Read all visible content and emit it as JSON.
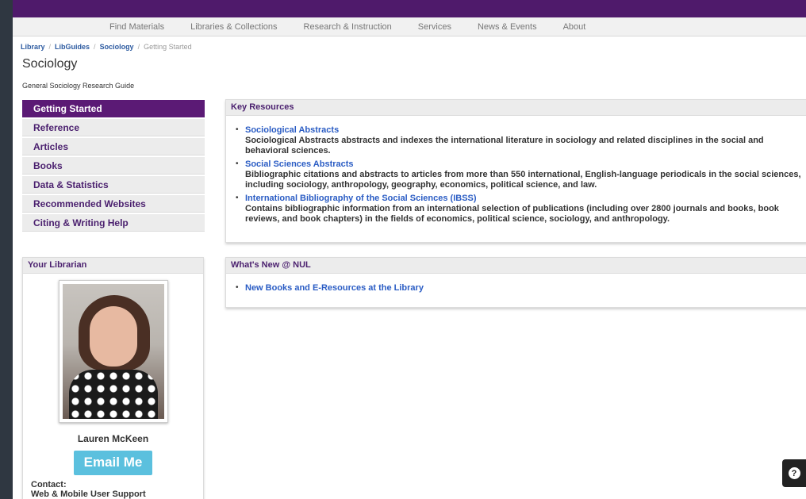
{
  "nav": {
    "items": [
      "Find Materials",
      "Libraries & Collections",
      "Research & Instruction",
      "Services",
      "News & Events",
      "About"
    ]
  },
  "breadcrumb": {
    "items": [
      "Library",
      "LibGuides",
      "Sociology"
    ],
    "current": "Getting Started"
  },
  "guide": {
    "title": "Sociology",
    "subtitle": "General Sociology Research Guide"
  },
  "sidenav": {
    "items": [
      {
        "label": "Getting Started",
        "active": true
      },
      {
        "label": "Reference",
        "active": false
      },
      {
        "label": "Articles",
        "active": false
      },
      {
        "label": "Books",
        "active": false
      },
      {
        "label": "Data & Statistics",
        "active": false
      },
      {
        "label": "Recommended Websites",
        "active": false
      },
      {
        "label": "Citing & Writing Help",
        "active": false
      }
    ]
  },
  "key_resources": {
    "heading": "Key Resources",
    "items": [
      {
        "title": "Sociological Abstracts",
        "description": "Sociological Abstracts abstracts and indexes the international literature in sociology and related disciplines in the social and behavioral sciences."
      },
      {
        "title": "Social Sciences Abstracts",
        "description": "Bibliographic citations and abstracts to articles from more than 550 international, English-language periodicals in the social sciences, including sociology, anthropology, geography, economics, political science, and law."
      },
      {
        "title": "International Bibliography of the Social Sciences (IBSS)",
        "description": "Contains bibliographic information from an international selection of publications (including over 2800 journals and books, book reviews, and book chapters) in the fields of economics, political science, sociology, and anthropology."
      }
    ]
  },
  "whats_new": {
    "heading": "What's New @ NUL",
    "items": [
      {
        "title": "New Books and E-Resources at the Library"
      }
    ]
  },
  "librarian": {
    "heading": "Your Librarian",
    "name": "Lauren McKeen",
    "email_label": "Email Me",
    "contact_label": "Contact:",
    "contact_value": "Web & Mobile User Support"
  },
  "help_button": {
    "icon": "question-icon",
    "glyph": "?"
  },
  "colors": {
    "brand": "#4f1a6b",
    "active": "#5b1a75",
    "link": "#2a5cc4",
    "email_button": "#5bc0de"
  }
}
